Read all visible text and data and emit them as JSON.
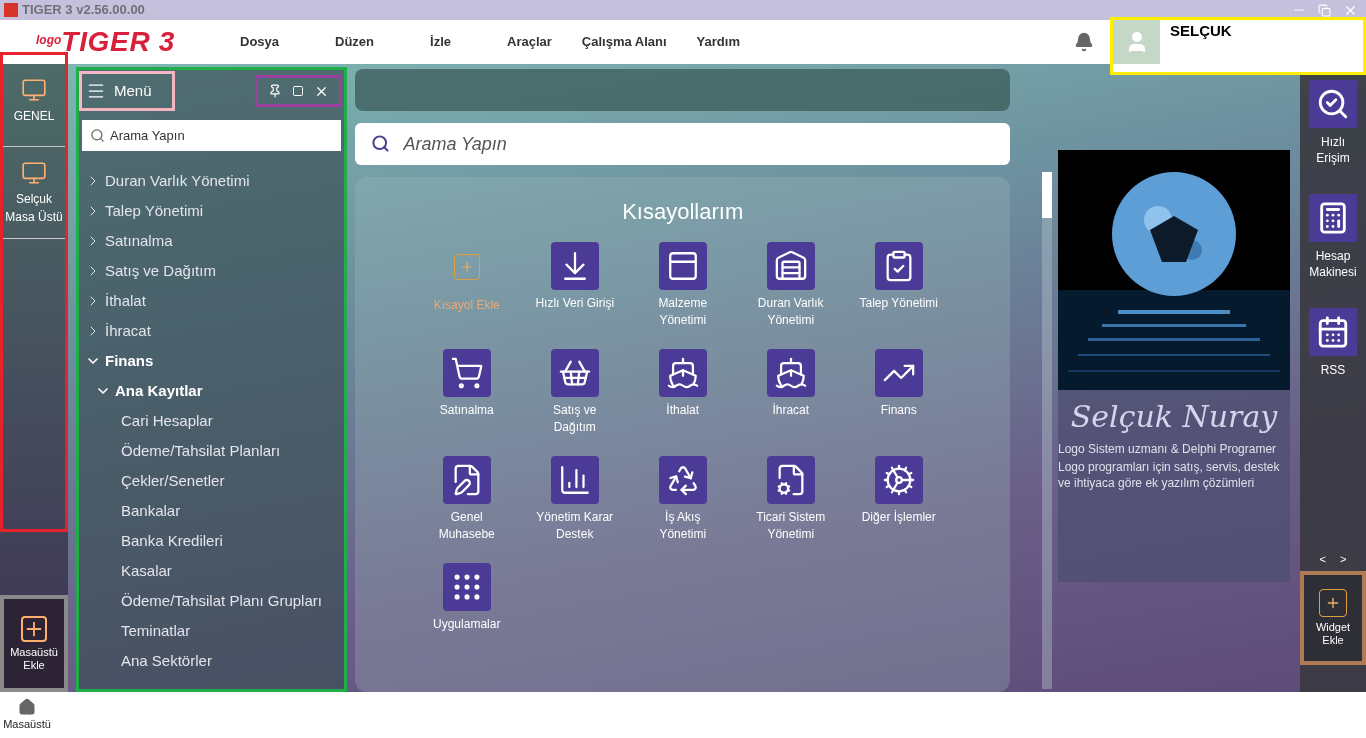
{
  "window": {
    "title": "TIGER 3 v2.56.00.00"
  },
  "header": {
    "logo_small": "logo",
    "logo": "TIGER 3",
    "menu": [
      "Dosya",
      "Düzen",
      "İzle",
      "Araçlar",
      "Çalışma Alanı",
      "Yardım"
    ],
    "user": {
      "name": "SELÇUK"
    }
  },
  "left_nav": {
    "items": [
      {
        "title": "GENEL"
      },
      {
        "title": "Selçuk",
        "subtitle": "Masa Üstü"
      }
    ],
    "add": {
      "label": "Masaüstü Ekle"
    }
  },
  "menu_panel": {
    "title": "Menü",
    "search": {
      "placeholder": "Arama Yapın"
    },
    "tree": [
      {
        "label": "Duran Varlık Yönetimi",
        "expanded": false
      },
      {
        "label": "Talep Yönetimi",
        "expanded": false
      },
      {
        "label": "Satınalma",
        "expanded": false
      },
      {
        "label": "Satış ve Dağıtım",
        "expanded": false
      },
      {
        "label": "İthalat",
        "expanded": false
      },
      {
        "label": "İhracat",
        "expanded": false
      },
      {
        "label": "Finans",
        "expanded": true,
        "children": [
          {
            "label": "Ana Kayıtlar",
            "expanded": true,
            "children": [
              {
                "label": "Cari Hesaplar"
              },
              {
                "label": "Ödeme/Tahsilat Planları"
              },
              {
                "label": "Çekler/Senetler"
              },
              {
                "label": "Bankalar"
              },
              {
                "label": "Banka Kredileri"
              },
              {
                "label": "Kasalar"
              },
              {
                "label": "Ödeme/Tahsilat Planı Grupları"
              },
              {
                "label": "Teminatlar"
              },
              {
                "label": "Ana Sektörler"
              }
            ]
          }
        ]
      }
    ]
  },
  "main": {
    "search": {
      "placeholder": "Arama Yapın"
    },
    "shortcuts_title": "Kısayollarım",
    "shortcuts": [
      {
        "kind": "add",
        "label": "Kısayol Ekle"
      },
      {
        "kind": "app",
        "label": "Hızlı Veri Girişi"
      },
      {
        "kind": "app",
        "label": "Malzeme Yönetimi"
      },
      {
        "kind": "app",
        "label": "Duran Varlık Yönetimi"
      },
      {
        "kind": "app",
        "label": "Talep Yönetimi"
      },
      {
        "kind": "app",
        "label": "Satınalma"
      },
      {
        "kind": "app",
        "label": "Satış ve Dağıtım"
      },
      {
        "kind": "app",
        "label": "İthalat"
      },
      {
        "kind": "app",
        "label": "İhracat"
      },
      {
        "kind": "app",
        "label": "Finans"
      },
      {
        "kind": "app",
        "label": "Genel Muhasebe"
      },
      {
        "kind": "app",
        "label": "Yönetim Karar Destek"
      },
      {
        "kind": "app",
        "label": "İş Akış Yönetimi"
      },
      {
        "kind": "app",
        "label": "Ticari Sistem Yönetimi"
      },
      {
        "kind": "app",
        "label": "Diğer İşlemler"
      },
      {
        "kind": "app",
        "label": "Uygulamalar"
      }
    ]
  },
  "widget": {
    "kind": "picture",
    "title": "Selçuk Nuray",
    "lines": [
      "Logo Sistem uzmanı & Delphi Programer",
      "Logo programları için satış, servis, destek ve ihtiyaca göre ek yazılım çözümleri"
    ],
    "prev": "<",
    "next": ">"
  },
  "right_bar": {
    "items": [
      {
        "label": "Hızlı Erişim"
      },
      {
        "label": "Hesap Makinesi"
      },
      {
        "label": "RSS"
      }
    ],
    "add": {
      "label": "Widget Ekle"
    }
  },
  "taskbar": {
    "label": "Masaüstü"
  }
}
